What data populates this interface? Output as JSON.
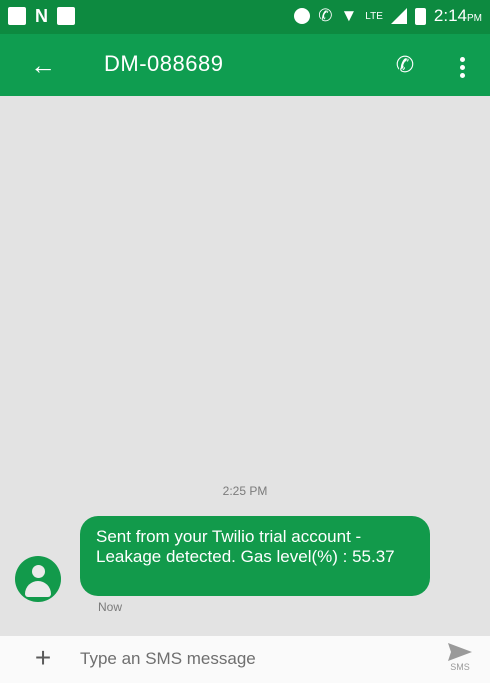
{
  "status_bar": {
    "time": "2:14",
    "time_suffix": "PM",
    "network": "LTE",
    "icons": [
      "qr-icon",
      "nfc-icon",
      "image-icon",
      "dnd-icon",
      "volte-icon",
      "wifi-icon",
      "signal-icon",
      "battery-icon"
    ]
  },
  "app_bar": {
    "title": "DM-088689",
    "back_icon": "arrow-left-icon",
    "call_icon": "phone-icon",
    "more_icon": "more-vert-icon",
    "color": "#0f9d50"
  },
  "conversation": {
    "timestamp": "2:25 PM",
    "messages": [
      {
        "text": "Sent from your Twilio trial account - Leakage detected. Gas level(%) : 55.37",
        "status": "Now",
        "sender_avatar": "person-icon"
      }
    ]
  },
  "compose": {
    "add_icon": "plus-icon",
    "placeholder": "Type an SMS message",
    "send_icon": "send-icon",
    "send_label": "SMS"
  }
}
